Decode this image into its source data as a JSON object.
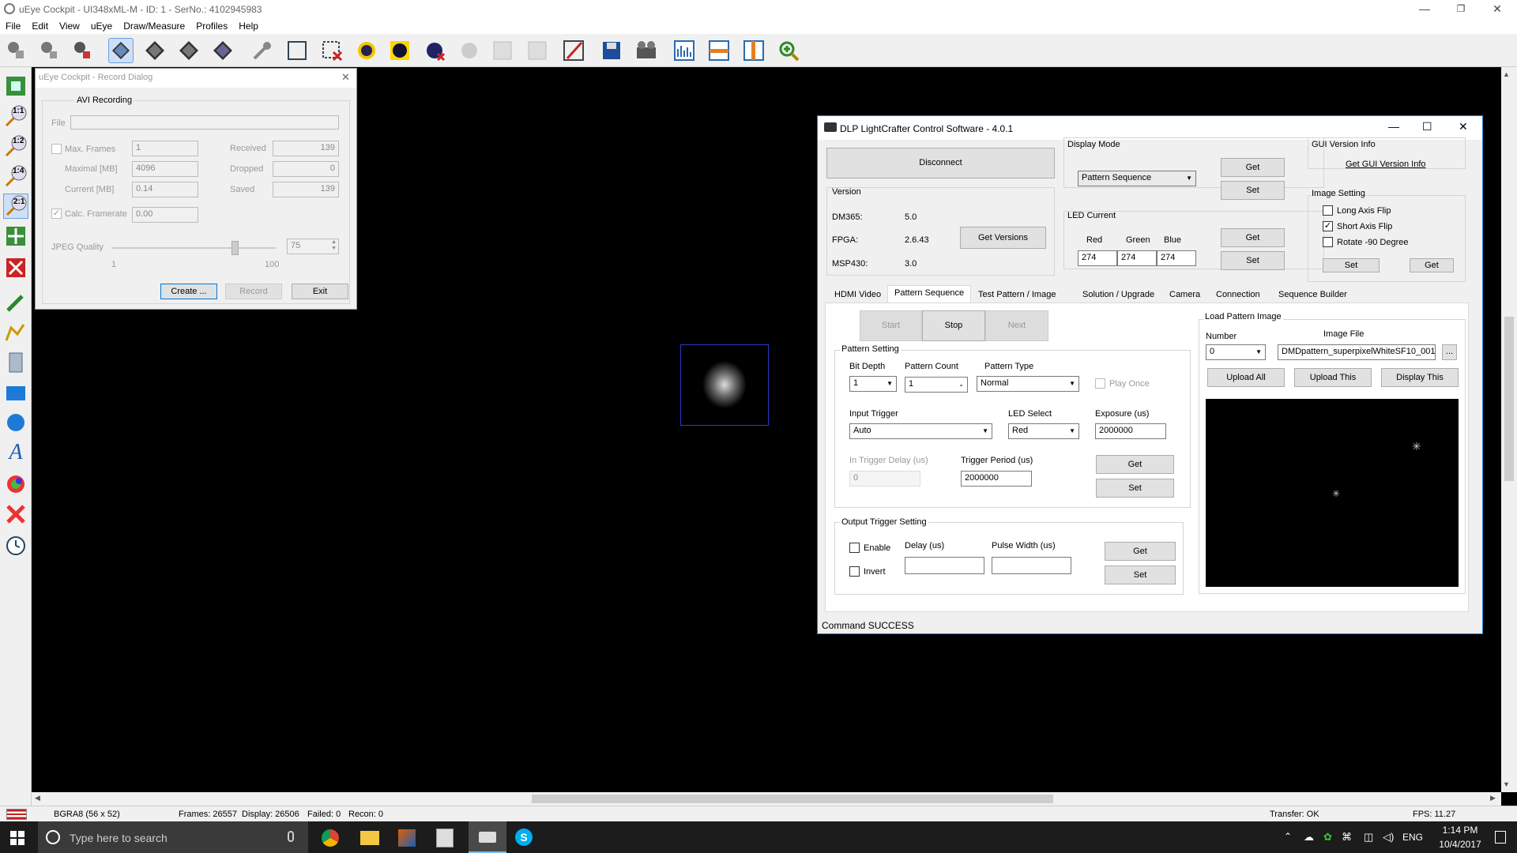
{
  "app": {
    "title": "uEye Cockpit - UI348xML-M - ID: 1 - SerNo.: 4102945983",
    "window_controls": [
      "—",
      "❐",
      "✕"
    ]
  },
  "menu": [
    "File",
    "Edit",
    "View",
    "uEye",
    "Draw/Measure",
    "Profiles",
    "Help"
  ],
  "lefttoolbar": {
    "zoom_labels": [
      "1:1",
      "1:2",
      "1:4",
      "2:1"
    ]
  },
  "record_dialog": {
    "title": "uEye Cockpit - Record Dialog",
    "group": "AVI Recording",
    "file_label": "File",
    "file_value": "",
    "max_frames_label": "Max. Frames",
    "max_frames_value": "1",
    "maximal_label": "Maximal [MB]",
    "maximal_value": "4096",
    "current_label": "Current [MB]",
    "current_value": "0.14",
    "calc_framerate_label": "Calc. Framerate",
    "calc_framerate_value": "0.00",
    "received_label": "Received",
    "received_value": "139",
    "dropped_label": "Dropped",
    "dropped_value": "0",
    "saved_label": "Saved",
    "saved_value": "139",
    "jpeg_label": "JPEG Quality",
    "jpeg_value": "75",
    "jpeg_min": "1",
    "jpeg_max": "100",
    "jpeg_fraction": 0.75,
    "create_btn": "Create ...",
    "record_btn": "Record",
    "exit_btn": "Exit"
  },
  "dlp": {
    "title": "DLP LightCrafter Control Software - 4.0.1",
    "disconnect_btn": "Disconnect",
    "version_group": "Version",
    "dm365_label": "DM365:",
    "dm365_value": "5.0",
    "fpga_label": "FPGA:",
    "fpga_value": "2.6.43",
    "msp430_label": "MSP430:",
    "msp430_value": "3.0",
    "get_versions_btn": "Get Versions",
    "display_mode_group": "Display Mode",
    "display_mode_value": "Pattern Sequence",
    "get_btn": "Get",
    "set_btn": "Set",
    "led_current_group": "LED Current",
    "red_label": "Red",
    "green_label": "Green",
    "blue_label": "Blue",
    "red_value": "274",
    "green_value": "274",
    "blue_value": "274",
    "gui_version_group": "GUI Version Info",
    "gui_version_link": "Get GUI Version Info",
    "image_setting_group": "Image Setting",
    "long_axis_flip": "Long Axis Flip",
    "short_axis_flip": "Short Axis Flip",
    "rotate": "Rotate -90 Degree",
    "tabs": [
      "HDMI Video",
      "Pattern Sequence",
      "Test Pattern / Image",
      "Solution / Upgrade",
      "Camera",
      "Connection",
      "Sequence Builder"
    ],
    "start_btn": "Start",
    "stop_btn": "Stop",
    "next_btn": "Next",
    "pattern_setting_group": "Pattern Setting",
    "bit_depth_label": "Bit Depth",
    "bit_depth_value": "1",
    "pattern_count_label": "Pattern Count",
    "pattern_count_value": "1",
    "pattern_type_label": "Pattern Type",
    "pattern_type_value": "Normal",
    "play_once_label": "Play Once",
    "input_trigger_label": "Input Trigger",
    "input_trigger_value": "Auto",
    "led_select_label": "LED Select",
    "led_select_value": "Red",
    "exposure_label": "Exposure (us)",
    "exposure_value": "2000000",
    "in_trigger_delay_label": "In Trigger Delay (us)",
    "in_trigger_delay_value": "0",
    "trigger_period_label": "Trigger Period (us)",
    "trigger_period_value": "2000000",
    "output_trigger_group": "Output Trigger Setting",
    "enable_label": "Enable",
    "invert_label": "Invert",
    "delay_label": "Delay (us)",
    "pulse_width_label": "Pulse Width (us)",
    "load_pattern_group": "Load Pattern Image",
    "number_label": "Number",
    "number_value": "0",
    "image_file_label": "Image File",
    "image_file_value": "DMDpattern_superpixelWhiteSF10_001",
    "browse_btn": "...",
    "upload_all_btn": "Upload All",
    "upload_this_btn": "Upload This",
    "display_this_btn": "Display This",
    "status": "Command SUCCESS"
  },
  "statusbar": {
    "format": "BGRA8 (56 x 52)",
    "frames": "Frames: 26557",
    "display": "Display: 26506",
    "failed": "Failed: 0",
    "recon": "Recon: 0",
    "transfer": "Transfer: OK",
    "fps": "FPS: 11.27"
  },
  "taskbar": {
    "search_placeholder": "Type here to search",
    "language": "ENG",
    "time": "1:14 PM",
    "date": "10/4/2017"
  },
  "colors": {
    "accent": "#1883d7",
    "taskbar": "#1c1c1c",
    "viewport": "#000000"
  }
}
